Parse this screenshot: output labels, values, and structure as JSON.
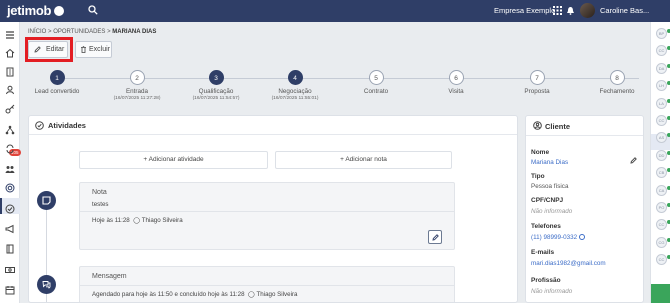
{
  "header": {
    "logo": "jetimob",
    "company": "Empresa Exemplo",
    "user": "Caroline Bas..."
  },
  "breadcrumb": {
    "home": "INÍCIO",
    "section": "OPORTUNIDADES",
    "current": "MARIANA DIAS"
  },
  "toolbar": {
    "edit": "Editar",
    "delete": "Excluir"
  },
  "steps": [
    {
      "num": "1",
      "label": "Lead convertido",
      "date": "",
      "done": true
    },
    {
      "num": "2",
      "label": "Entrada",
      "date": "(16/07/2025 11:27:28)",
      "done": false
    },
    {
      "num": "3",
      "label": "Qualificação",
      "date": "(16/07/2025 11:54:57)",
      "done": true
    },
    {
      "num": "4",
      "label": "Negociação",
      "date": "(16/07/2025 11:55:01)",
      "done": true
    },
    {
      "num": "5",
      "label": "Contrato",
      "date": "",
      "done": false
    },
    {
      "num": "6",
      "label": "Visita",
      "date": "",
      "done": false
    },
    {
      "num": "7",
      "label": "Proposta",
      "date": "",
      "done": false
    },
    {
      "num": "8",
      "label": "Fechamento",
      "date": "",
      "done": false
    }
  ],
  "activities": {
    "title": "Atividades",
    "add_activity": "+ Adicionar atividade",
    "add_note": "+ Adicionar nota",
    "note": {
      "title": "Nota",
      "body": "testes",
      "time": "Hoje às 11:28",
      "author": "Thiago Silveira"
    },
    "message": {
      "title": "Mensagem",
      "meta": "Agendado para hoje às 11:50 e concluído hoje às 11:28",
      "author": "Thiago Silveira"
    }
  },
  "client": {
    "title": "Cliente",
    "fields": [
      {
        "label": "Nome",
        "value": "Mariana Dias",
        "style": "link"
      },
      {
        "label": "Tipo",
        "value": "Pessoa física",
        "style": "plain"
      },
      {
        "label": "CPF/CNPJ",
        "value": "Não informado",
        "style": "empty"
      },
      {
        "label": "Telefones",
        "value": "(11) 98999-0332",
        "style": "link"
      },
      {
        "label": "E-mails",
        "value": "mari.dias1982@gmail.com",
        "style": "link"
      },
      {
        "label": "Profissão",
        "value": "Não informado",
        "style": "empty"
      }
    ]
  },
  "side_badge": "105",
  "right_rail": [
    "BP",
    "CC",
    "DA",
    "LH",
    "LA",
    "CC",
    "AS",
    "DD",
    "CB",
    "CA",
    "PO",
    "CC",
    "CG",
    "CC"
  ],
  "colors": {
    "primary": "#2f3e67",
    "highlight": "#e31d23",
    "link": "#3b6cc7",
    "online": "#3aa55b"
  },
  "icons": {
    "sidebar": [
      "home-icon",
      "building-icon",
      "user-icon",
      "key-icon",
      "network-icon",
      "sync-icon",
      "team-icon",
      "target-icon",
      "check-icon",
      "megaphone-icon",
      "book-icon",
      "money-icon",
      "calendar-icon"
    ]
  }
}
